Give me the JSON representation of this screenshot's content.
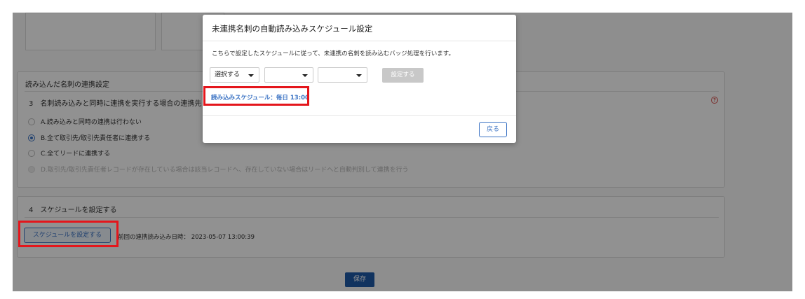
{
  "background": {
    "section3": {
      "header": "読み込んだ名刺の連携設定",
      "title": "3　名刺読み込みと同時に連携を実行する場合の連携先",
      "options": [
        {
          "label": "A.読み込みと同時の連携は行わない",
          "checked": false,
          "disabled": false
        },
        {
          "label": "B.全て取引先/取引先責任者に連携する",
          "checked": true,
          "disabled": false
        },
        {
          "label": "C.全てリードに連携する",
          "checked": false,
          "disabled": false
        },
        {
          "label": "D.取引先/取引先責任者レコードが存在している場合は該当レコードへ、存在していない場合はリードへと自動判別して連携を行う",
          "checked": false,
          "disabled": true
        }
      ],
      "help_icon": "question-circle-icon"
    },
    "section4": {
      "title": "4　スケジュールを設定する",
      "button_label": "スケジュールを設定する",
      "last_read": "前回の連携読み込み日時：  2023-05-07 13:00:39"
    },
    "save_label": "保存"
  },
  "modal": {
    "title": "未連携名刺の自動読み込みスケジュール設定",
    "description": "こちらで設定したスケジュールに従って、未連携の名刺を読み込むバッジ処理を行います。",
    "select1": "選択する",
    "select2": "",
    "select3": "",
    "set_label": "設定する",
    "schedule_text": "読み込みスケジュール：毎日 13:00",
    "back_label": "戻る"
  },
  "colors": {
    "accent": "#3b73c4",
    "save": "#1e5aa8",
    "highlight": "#e4161c",
    "help": "#d9534f"
  }
}
